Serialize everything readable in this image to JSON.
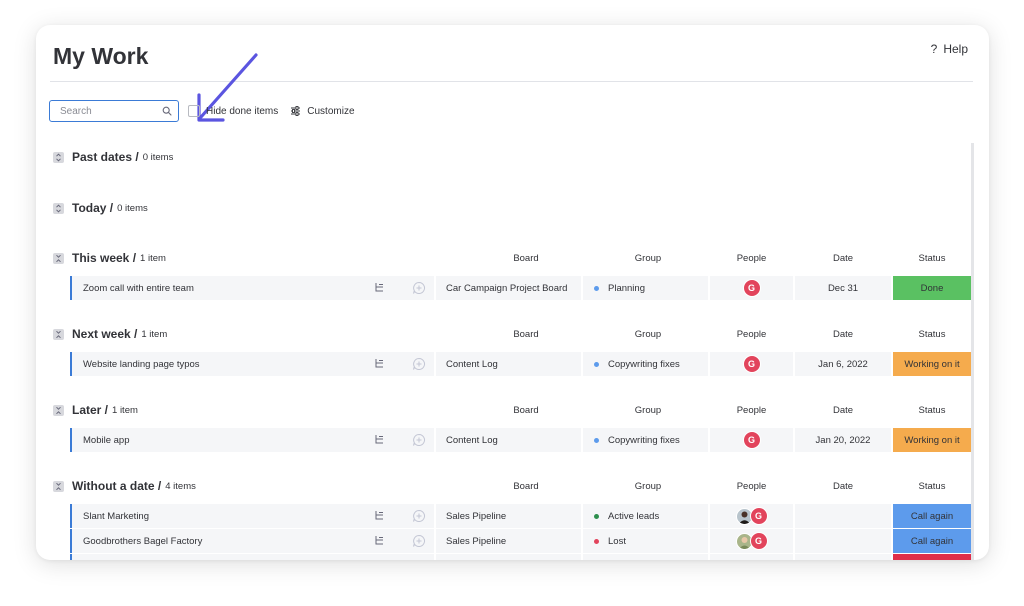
{
  "page": {
    "title": "My Work",
    "help_label": "Help"
  },
  "toolbar": {
    "search_placeholder": "Search",
    "hide_done_label": "Hide done items",
    "customize_label": "Customize"
  },
  "columns": {
    "board": "Board",
    "group": "Group",
    "people": "People",
    "date": "Date",
    "status": "Status"
  },
  "colors": {
    "accent": "#3b7bd6",
    "done": "#5ac162",
    "working": "#f5ab4d",
    "call_again": "#5d9bec",
    "stuck": "#df2f4a",
    "avatar": "#e2445c",
    "annotation_arrow": "#5b55e0"
  },
  "groups": [
    {
      "title": "Past dates",
      "count": "0 items"
    },
    {
      "title": "Today",
      "count": "0 items"
    },
    {
      "title": "This week",
      "count": "1 item",
      "items": [
        {
          "name": "Zoom call with entire team",
          "board": "Car Campaign Project Board",
          "group": "Planning",
          "avatar": "G",
          "date": "Dec 31",
          "status": "Done"
        }
      ]
    },
    {
      "title": "Next week",
      "count": "1 item",
      "items": [
        {
          "name": "Website landing page typos",
          "board": "Content Log",
          "group": "Copywriting fixes",
          "avatar": "G",
          "date": "Jan 6, 2022",
          "status": "Working on it"
        }
      ]
    },
    {
      "title": "Later",
      "count": "1 item",
      "items": [
        {
          "name": "Mobile app",
          "board": "Content Log",
          "group": "Copywriting fixes",
          "avatar": "G",
          "date": "Jan 20, 2022",
          "status": "Working on it"
        }
      ]
    },
    {
      "title": "Without a date",
      "count": "4 items",
      "items": [
        {
          "name": "Slant Marketing",
          "board": "Sales Pipeline",
          "group": "Active leads",
          "avatar": "G",
          "date": "",
          "status": "Call again"
        },
        {
          "name": "Goodbrothers Bagel Factory",
          "board": "Sales Pipeline",
          "group": "Lost",
          "avatar": "G",
          "date": "",
          "status": "Call again"
        }
      ]
    }
  ],
  "icons": {
    "help": "question-mark-icon",
    "search": "search-icon",
    "customize": "sliders-icon",
    "toggle_collapsed": "expand-icon",
    "toggle_expanded": "collapse-icon",
    "subitems": "subitems-icon",
    "updates": "add-update-icon"
  }
}
